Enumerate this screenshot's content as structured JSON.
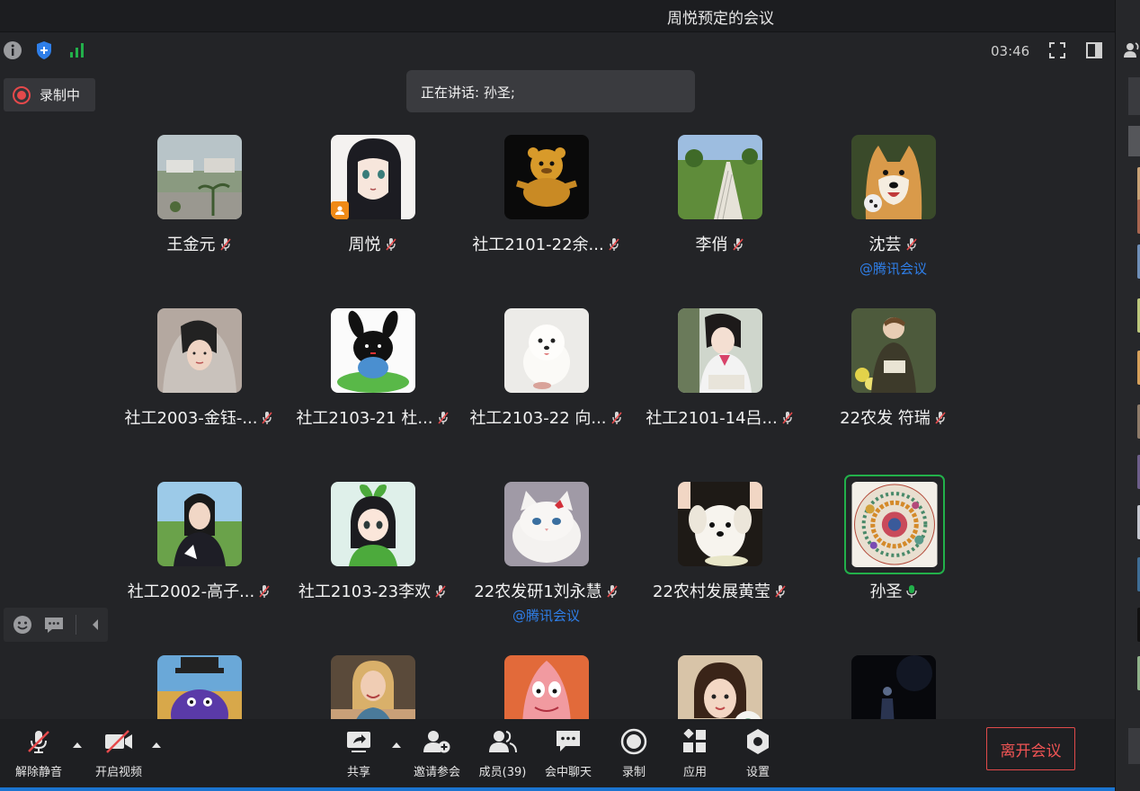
{
  "window": {
    "title": "周悦预定的会议"
  },
  "status": {
    "time": "03:46",
    "recording_label": "录制中",
    "speaking_text": "正在讲话: 孙圣;"
  },
  "participants": [
    {
      "name": "王金元",
      "muted": true,
      "avatar": "campus"
    },
    {
      "name": "周悦",
      "muted": true,
      "avatar": "anime-girl",
      "host": true
    },
    {
      "name": "社工2101-22余...",
      "muted": true,
      "avatar": "bear"
    },
    {
      "name": "李俏",
      "muted": true,
      "avatar": "park-path"
    },
    {
      "name": "沈芸",
      "muted": true,
      "avatar": "shiba",
      "sub": "@腾讯会议"
    },
    {
      "name": "社工2003-金钰-...",
      "muted": true,
      "avatar": "girl-blanket"
    },
    {
      "name": "社工2103-21 杜...",
      "muted": true,
      "avatar": "black-bunny"
    },
    {
      "name": "社工2103-22 向...",
      "muted": true,
      "avatar": "white-dog"
    },
    {
      "name": "社工2101-14吕...",
      "muted": true,
      "avatar": "anime-study"
    },
    {
      "name": "22农发 符瑞",
      "muted": true,
      "avatar": "man-reading"
    },
    {
      "name": "社工2002-高子...",
      "muted": true,
      "avatar": "girl-field"
    },
    {
      "name": "社工2103-23李欢",
      "muted": true,
      "avatar": "anime-leaf"
    },
    {
      "name": "22农发研1刘永慧",
      "muted": true,
      "avatar": "white-cat",
      "sub": "@腾讯会议"
    },
    {
      "name": "22农村发展黄莹",
      "muted": true,
      "avatar": "puppy"
    },
    {
      "name": "孙圣",
      "muted": false,
      "speaking": true,
      "avatar": "mandala"
    },
    {
      "name": "",
      "avatar": "purple-creature"
    },
    {
      "name": "",
      "avatar": "woman-tv"
    },
    {
      "name": "",
      "avatar": "patrick"
    },
    {
      "name": "",
      "avatar": "child"
    },
    {
      "name": "",
      "avatar": "dark-stage"
    }
  ],
  "toolbar": {
    "unmute": "解除静音",
    "start_video": "开启视频",
    "share": "共享",
    "invite": "邀请参会",
    "members": "成员(39)",
    "chat": "会中聊天",
    "record": "录制",
    "apps": "应用",
    "settings": "设置",
    "leave": "离开会议"
  },
  "colors": {
    "accent_green": "#22b04a",
    "link_blue": "#2f7fe9",
    "leave_red": "#f05454",
    "record_red": "#e5494b"
  }
}
